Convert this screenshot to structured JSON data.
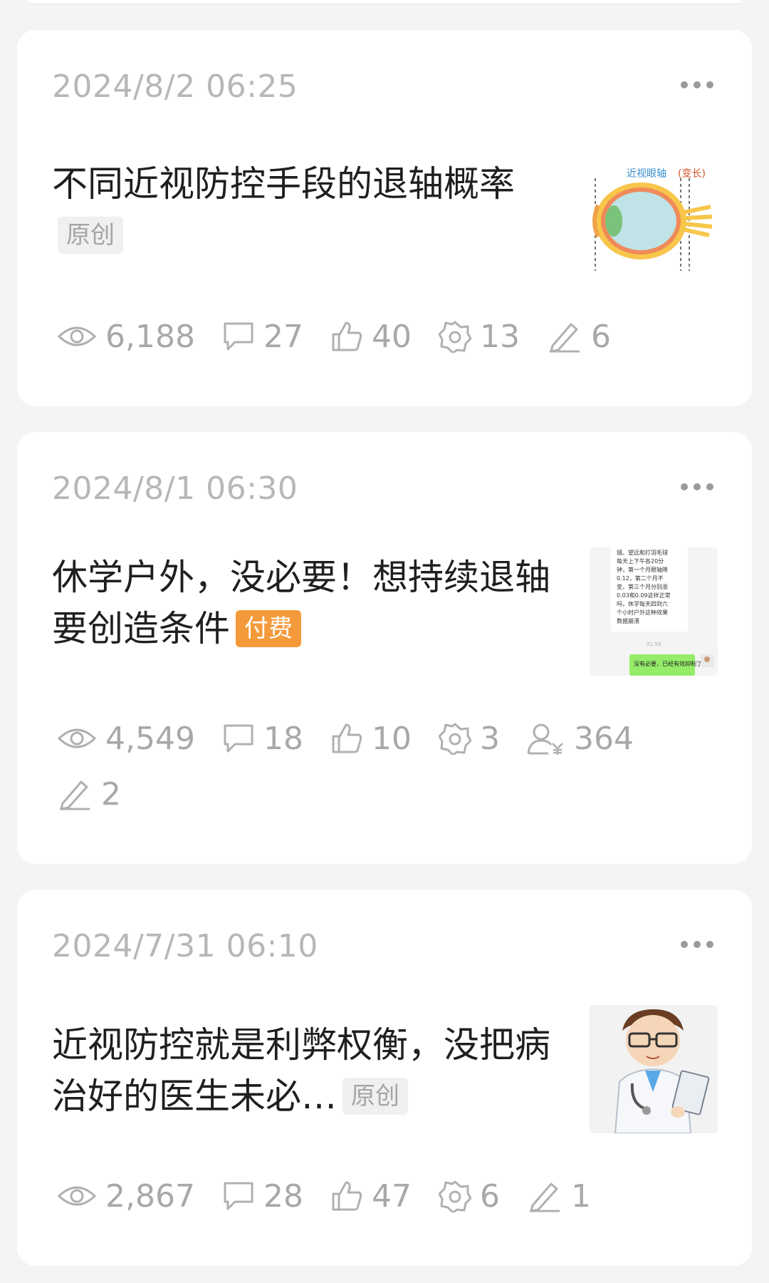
{
  "posts": [
    {
      "date": "2024/8/2 06:25",
      "title": "不同近视防控手段的退轴概率",
      "badge": "原创",
      "thumbnail": {
        "caption_main": "近视眼轴",
        "caption_accent": "(变长)"
      },
      "stats": {
        "views": "6,188",
        "comments": "27",
        "likes": "40",
        "shares": "13",
        "edits": "6"
      }
    },
    {
      "date": "2024/8/1 06:30",
      "title": "休学户外，没必要！想持续退轴要创造条件",
      "badge": "付费",
      "thumbnail": {
        "chat_lines": [
          "镜、望远和打羽毛球",
          "每天上下午各20分",
          "钟，第一个月眼轴降",
          "0.12，第二个月不",
          "变，第三个月分别涨",
          "0.03和0.09这样正常",
          "吗，休学每天四到六",
          "个小时户外这种效果",
          "数据崩溃"
        ],
        "chat_time": "21:59",
        "chat_reply": "没有必要，已经有效抑制了，不"
      },
      "stats": {
        "views": "4,549",
        "comments": "18",
        "likes": "10",
        "shares": "3",
        "paid_readers": "364",
        "edits": "2"
      }
    },
    {
      "date": "2024/7/31 06:10",
      "title": "近视防控就是利弊权衡，没把病治好的医生未必…",
      "badge": "原创",
      "stats": {
        "views": "2,867",
        "comments": "28",
        "likes": "47",
        "shares": "6",
        "edits": "1"
      }
    }
  ],
  "colors": {
    "paid_badge": "#f49a3a",
    "meta_gray": "#a8a8a8",
    "title": "#1f1f1f"
  },
  "icons": [
    "eye-icon",
    "comment-icon",
    "thumbs-up-icon",
    "share-flower-icon",
    "paid-reader-icon",
    "edit-pen-icon",
    "more-dots-icon"
  ]
}
